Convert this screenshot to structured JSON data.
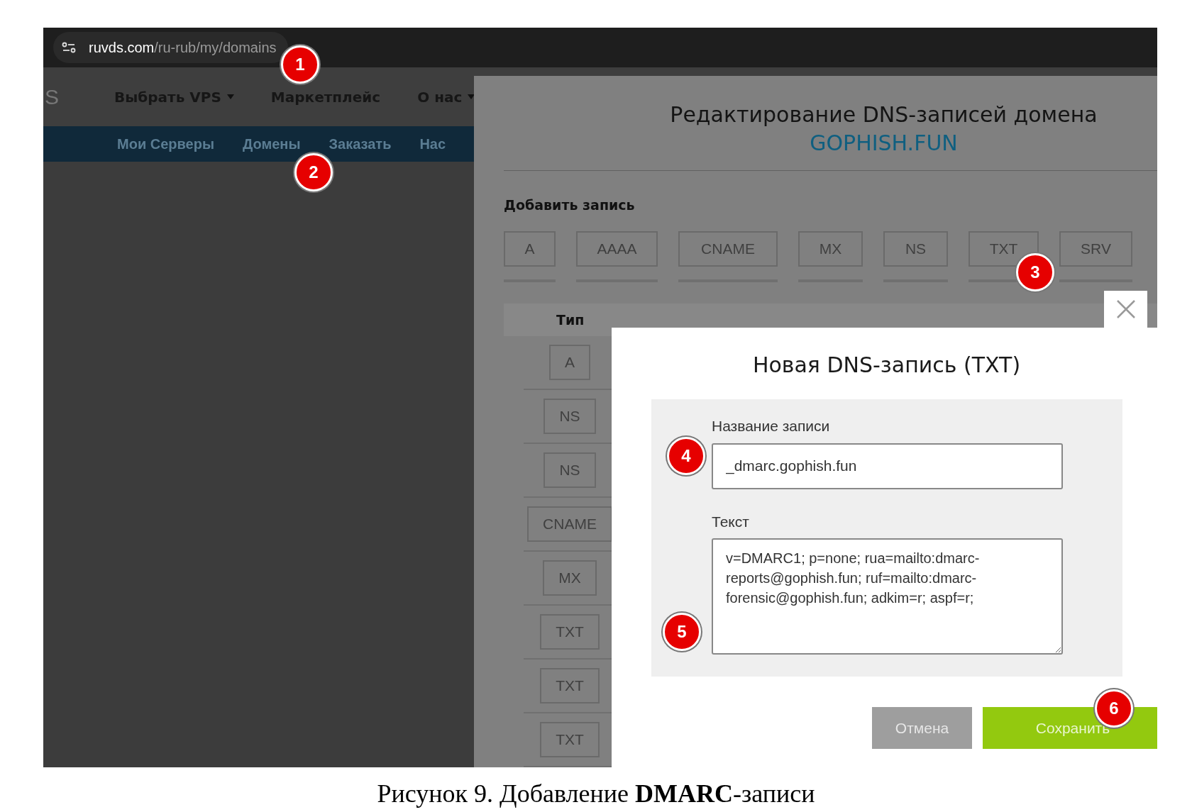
{
  "browser": {
    "url_host": "ruvds.com",
    "url_path": "/ru-rub/my/domains"
  },
  "site_nav": {
    "logo": "S",
    "items": [
      {
        "label": "Выбрать VPS",
        "has_menu": true
      },
      {
        "label": "Маркетплейс",
        "has_menu": false
      },
      {
        "label": "О нас",
        "has_menu": true
      }
    ]
  },
  "sub_nav": [
    "Мои Серверы",
    "Домены",
    "Заказать",
    "Нас"
  ],
  "dns_panel": {
    "title": "Редактирование DNS-записей домена",
    "domain": "GOPHISH.FUN",
    "add_label": "Добавить запись",
    "record_types": [
      "A",
      "AAAA",
      "CNAME",
      "MX",
      "NS",
      "TXT",
      "SRV"
    ],
    "table": {
      "type_header": "Тип",
      "rows": [
        "A",
        "NS",
        "NS",
        "CNAME",
        "MX",
        "TXT",
        "TXT",
        "TXT"
      ]
    }
  },
  "dialog": {
    "title": "Новая DNS-запись (TXT)",
    "name_label": "Название записи",
    "name_value": "_dmarc.gophish.fun",
    "text_label": "Текст",
    "text_value": "v=DMARC1; p=none; rua=mailto:dmarc-reports@gophish.fun; ruf=mailto:dmarc-forensic@gophish.fun; adkim=r; aspf=r;",
    "cancel": "Отмена",
    "save": "Сохранить"
  },
  "annotations": [
    "1",
    "2",
    "3",
    "4",
    "5",
    "6"
  ],
  "caption": "Рисунок 9. Добавление **DMARC**-записи"
}
